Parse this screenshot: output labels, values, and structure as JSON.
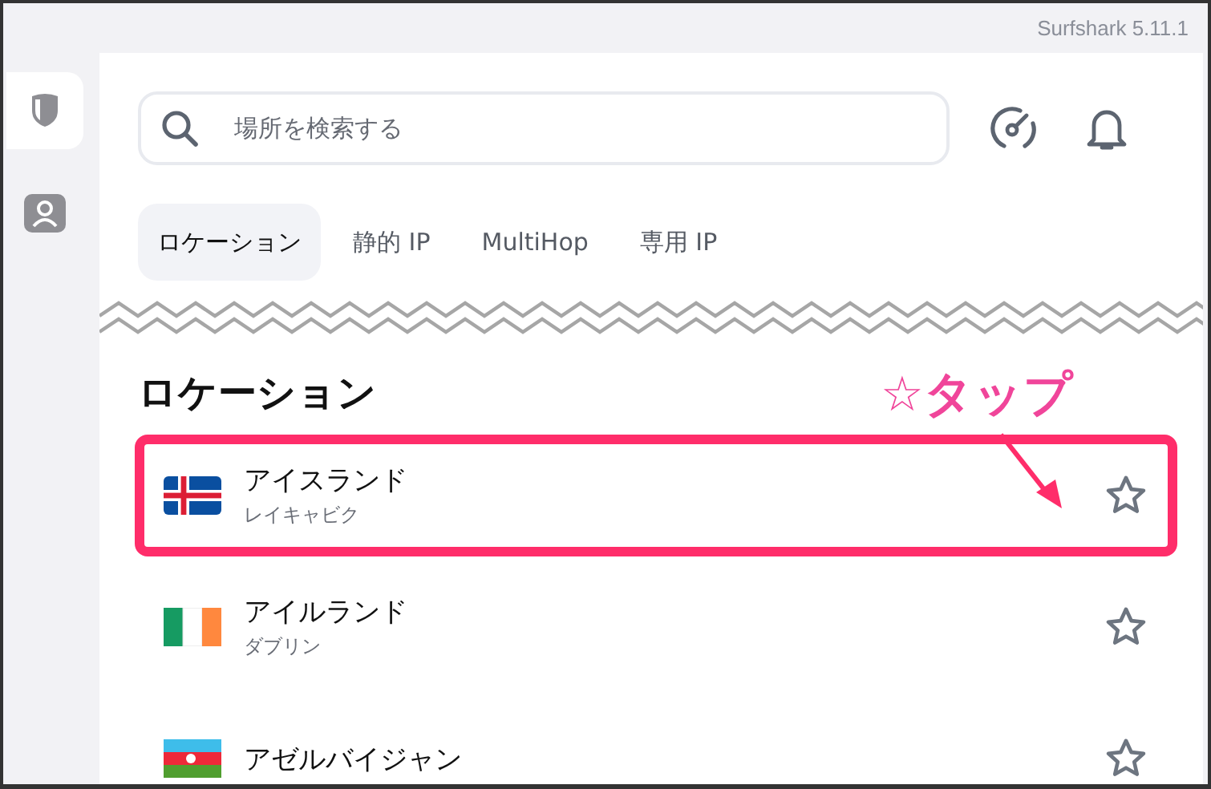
{
  "app_version": "Surfshark 5.11.1",
  "sidebar": {
    "items": [
      {
        "kind": "shield",
        "selected": true
      },
      {
        "kind": "person",
        "selected": false
      }
    ]
  },
  "search": {
    "placeholder": "場所を検索する"
  },
  "tabs": [
    {
      "label": "ロケーション",
      "selected": true
    },
    {
      "label": "静的 IP",
      "selected": false
    },
    {
      "label": "MultiHop",
      "selected": false
    },
    {
      "label": "専用 IP",
      "selected": false
    }
  ],
  "section_title": "ロケーション",
  "locations": [
    {
      "name": "アイスランド",
      "city": "レイキャビク",
      "kind": "iceland",
      "favorite": false,
      "highlighted": true
    },
    {
      "name": "アイルランド",
      "city": "ダブリン",
      "kind": "ireland",
      "favorite": false,
      "highlighted": false
    },
    {
      "name": "アゼルバイジャン",
      "kind": "azerbaijan",
      "favorite": false,
      "highlighted": false
    }
  ],
  "annotation": {
    "text": "☆タップ"
  }
}
